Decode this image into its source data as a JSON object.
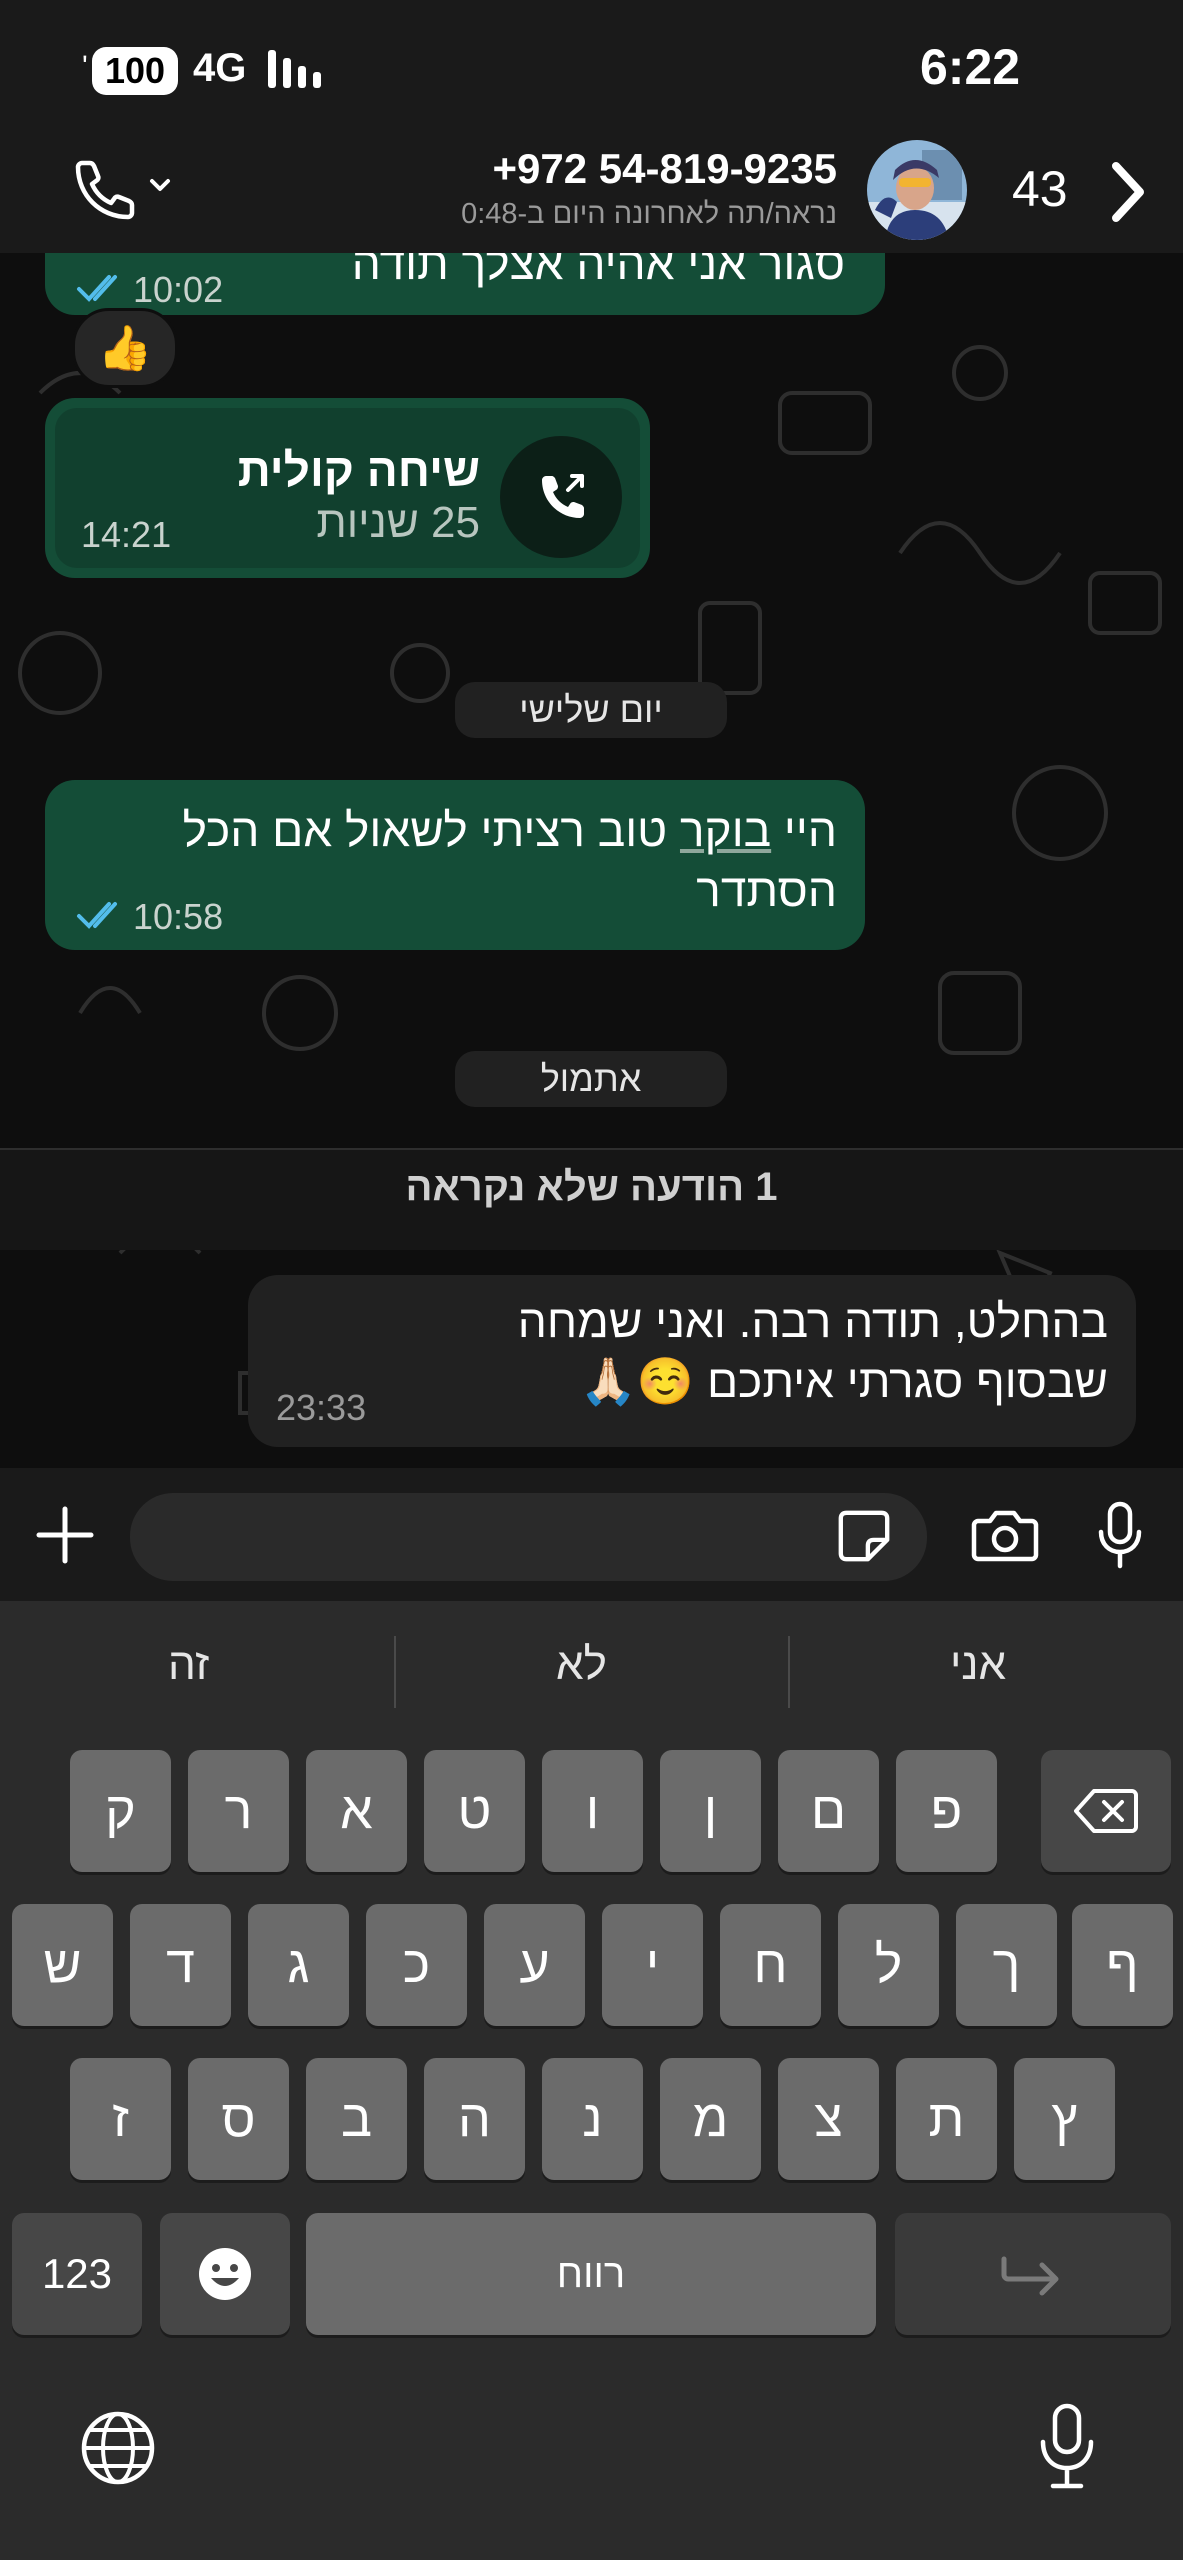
{
  "status_bar": {
    "battery": "100",
    "network": "4G",
    "time": "6:22"
  },
  "header": {
    "contact_name": "+972 54-819-9235",
    "last_seen": "נראה/תה לאחרונה היום ב-0:48",
    "unread_count": "43",
    "icons": [
      "phone-icon",
      "chevron-down-icon",
      "avatar",
      "chevron-right-icon"
    ]
  },
  "chat": {
    "partial_message": {
      "text": "סגור אני אהיה אצלך תודה",
      "time": "10:02",
      "reaction": "👍"
    },
    "voice_call": {
      "title": "שיחה קולית",
      "duration": "25 שניות",
      "time": "14:21"
    },
    "date_tuesday": "יום שלישי",
    "morning_message": {
      "text_part1": "היי ",
      "text_underlined": "בוקר",
      "text_part2": " טוב רציתי לשאול אם הכל הסתדר",
      "time": "10:58"
    },
    "date_yesterday": "אתמול",
    "unread_banner": "1 הודעה שלא נקראה",
    "incoming_message": {
      "line1": "בהחלט, תודה רבה. ואני שמחה",
      "line2": "שבסוף סגרתי איתכם ☺️🙏🏻",
      "time": "23:33"
    }
  },
  "composer": {
    "input_value": "",
    "icons": [
      "plus-icon",
      "sticker-icon",
      "camera-icon",
      "microphone-icon"
    ]
  },
  "keyboard": {
    "suggestions": [
      "אני",
      "לא",
      "זה"
    ],
    "row1": [
      "ק",
      "ר",
      "א",
      "ט",
      "ו",
      "ן",
      "ם",
      "פ"
    ],
    "row2": [
      "ש",
      "ד",
      "ג",
      "כ",
      "ע",
      "י",
      "ח",
      "ל",
      "ך",
      "ף"
    ],
    "row3": [
      "ז",
      "ס",
      "ב",
      "ה",
      "נ",
      "מ",
      "צ",
      "ת",
      "ץ"
    ],
    "numbers_key": "123",
    "space_key": "רווח",
    "icons": [
      "backspace-icon",
      "emoji-icon",
      "return-icon",
      "globe-icon",
      "dictation-icon"
    ]
  }
}
